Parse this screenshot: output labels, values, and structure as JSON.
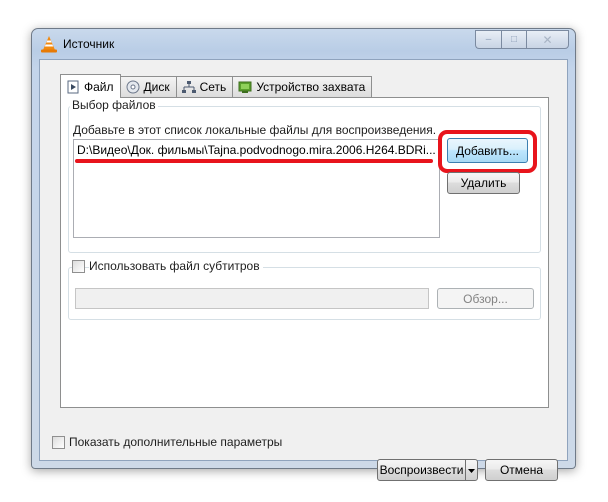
{
  "window": {
    "title": "Источник",
    "controls": {
      "minimize": "–",
      "maximize": "□",
      "close": "✕"
    }
  },
  "tabs": [
    {
      "label": "Файл",
      "icon": "file-icon",
      "active": true
    },
    {
      "label": "Диск",
      "icon": "disc-icon",
      "active": false
    },
    {
      "label": "Сеть",
      "icon": "network-icon",
      "active": false
    },
    {
      "label": "Устройство захвата",
      "icon": "capture-device-icon",
      "active": false
    }
  ],
  "file_selection": {
    "group_label": "Выбор файлов",
    "hint": "Добавьте в этот список локальные файлы для воспроизведения.",
    "files": [
      "D:\\Видео\\Док. фильмы\\Tajna.podvodnogo.mira.2006.H264.BDRi..."
    ],
    "add_button": "Добавить...",
    "remove_button": "Удалить"
  },
  "subtitles": {
    "checkbox_label": "Использовать файл субтитров",
    "checked": false,
    "path_value": "",
    "browse_button": "Обзор..."
  },
  "footer": {
    "advanced_checkbox_label": "Показать дополнительные параметры",
    "advanced_checked": false,
    "play_button": "Воспроизвести",
    "cancel_button": "Отмена"
  },
  "colors": {
    "annotation_red": "#e8141c",
    "focus_blue": "#3c7fb1"
  }
}
